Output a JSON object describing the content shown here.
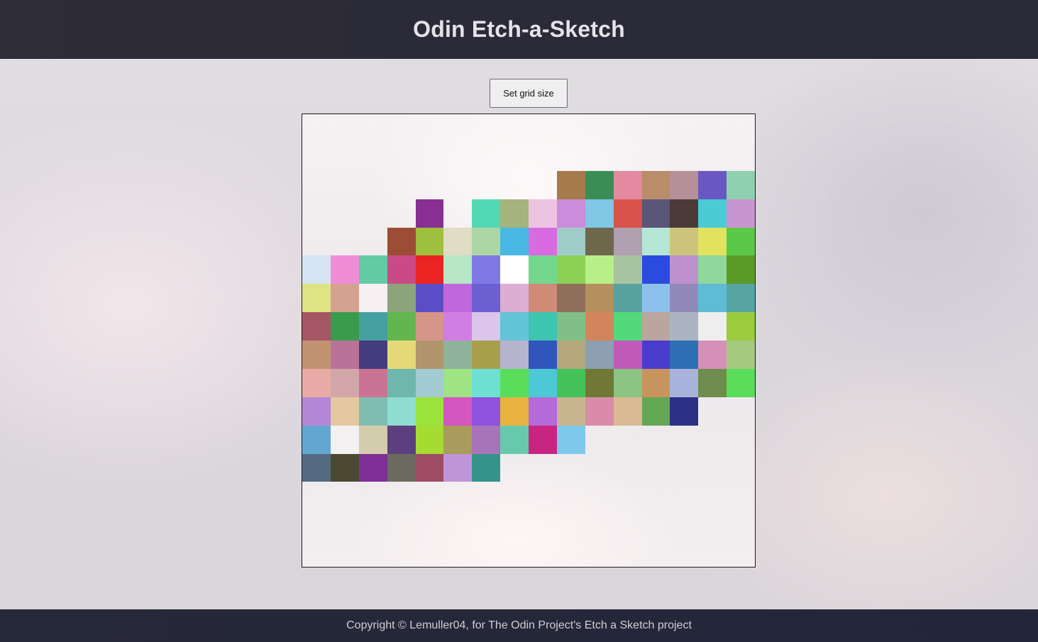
{
  "header": {
    "title": "Odin Etch-a-Sketch"
  },
  "controls": {
    "set_grid_label": "Set grid size"
  },
  "grid": {
    "size": 16,
    "rows": [
      [
        "",
        "",
        "",
        "",
        "",
        "",
        "",
        "",
        "",
        "",
        "",
        "",
        "",
        "",
        "",
        ""
      ],
      [
        "",
        "",
        "",
        "",
        "",
        "",
        "",
        "",
        "",
        "",
        "",
        "",
        "",
        "",
        "",
        ""
      ],
      [
        "",
        "",
        "",
        "",
        "",
        "",
        "",
        "",
        "",
        "#a67b4c",
        "#3a8e55",
        "#e38aa0",
        "#b98c6a",
        "#b69098",
        "#6a58c2",
        "#8fd0b0"
      ],
      [
        "",
        "",
        "",
        "",
        "#892e92",
        "",
        "#53d8b6",
        "#a4b47c",
        "#ecc4df",
        "#cb8cdc",
        "#7ec8e6",
        "#d9524a",
        "#5a5679",
        "#4b3b38",
        "#4bcbd6",
        "#c895d0"
      ],
      [
        "",
        "",
        "",
        "#9d4c36",
        "#9ec03e",
        "#e0dcc6",
        "#acd7a4",
        "#49b7e3",
        "#d96be2",
        "#a0cdc8",
        "#6d684c",
        "#b0a0b0",
        "#b6e6d6",
        "#ccc47c",
        "#e1e35e",
        "#5bc947"
      ],
      [
        "#d4e4f2",
        "#f08dd6",
        "#63caa6",
        "#c94a86",
        "#ea2323",
        "#b7e6c6",
        "#7f7ae3",
        "#ffffff",
        "#73d88b",
        "#8cd055",
        "#b9ef88",
        "#a7c4a0",
        "#2b4be0",
        "#be90cc",
        "#90d79c",
        "#5a9a25"
      ],
      [
        "#dfe384",
        "#d3a390",
        "#f6f0f2",
        "#8ca37b",
        "#5b4dc5",
        "#c068db",
        "#6b60d1",
        "#ddaed3",
        "#cf8b77",
        "#8f6f5b",
        "#b68f5f",
        "#58a3a0",
        "#8dc1ec",
        "#9289bb",
        "#5ebcd5",
        "#57a5a3"
      ],
      [
        "#a55664",
        "#3a9b4d",
        "#45a0a2",
        "#63b64f",
        "#d69687",
        "#d17de4",
        "#dbc5ec",
        "#63c4d8",
        "#3ec5b0",
        "#80bf86",
        "#d2855b",
        "#51d97c",
        "#bba69e",
        "#abb5c1",
        "#eeeeef",
        "#9acc3e"
      ],
      [
        "#c19272",
        "#b97399",
        "#453c7d",
        "#e5d879",
        "#b0956d",
        "#8fb39a",
        "#a9a04e",
        "#b7b4cf",
        "#3056bd",
        "#b4a87c",
        "#8d9fb1",
        "#c05bb7",
        "#4a3dcd",
        "#2e6fb3",
        "#d590ba",
        "#a5c97e"
      ],
      [
        "#e8aaa5",
        "#d3a6a9",
        "#cb7392",
        "#6fb7ad",
        "#a3cbd2",
        "#9ee384",
        "#6ee0d3",
        "#5bdd5c",
        "#4cc9d5",
        "#45c35b",
        "#6f7835",
        "#8cc484",
        "#c8945e",
        "#a8b2da",
        "#6e8c4c",
        "#5add5a"
      ],
      [
        "#b488d6",
        "#e4c8a0",
        "#7fbcb2",
        "#8fdcd0",
        "#9be23d",
        "#d556c0",
        "#8f52dc",
        "#e8b23e",
        "#b46ad9",
        "#c9b58d",
        "#d98ca8",
        "#dcb995",
        "#64a753",
        "#2d2f86",
        "",
        ""
      ],
      [
        "#64a6d2",
        "#f3f0f2",
        "#d4cdac",
        "#5b3f7e",
        "#a4dc31",
        "#a99c5c",
        "#a874b9",
        "#67c9ab",
        "#c82582",
        "#7ec8eb",
        "",
        "",
        "",
        "",
        "",
        ""
      ],
      [
        "#546a80",
        "#4c4832",
        "#7f2f95",
        "#6b6b5f",
        "#9e4b63",
        "#bf95da",
        "#34938b",
        "",
        "",
        "",
        "",
        "",
        "",
        "",
        "",
        ""
      ],
      [
        "",
        "",
        "",
        "",
        "",
        "",
        "",
        "",
        "",
        "",
        "",
        "",
        "",
        "",
        "",
        ""
      ],
      [
        "",
        "",
        "",
        "",
        "",
        "",
        "",
        "",
        "",
        "",
        "",
        "",
        "",
        "",
        "",
        ""
      ],
      [
        "",
        "",
        "",
        "",
        "",
        "",
        "",
        "",
        "",
        "",
        "",
        "",
        "",
        "",
        "",
        ""
      ]
    ]
  },
  "footer": {
    "text": "Copyright © Lemuller04, for The Odin Project's Etch a Sketch project"
  }
}
